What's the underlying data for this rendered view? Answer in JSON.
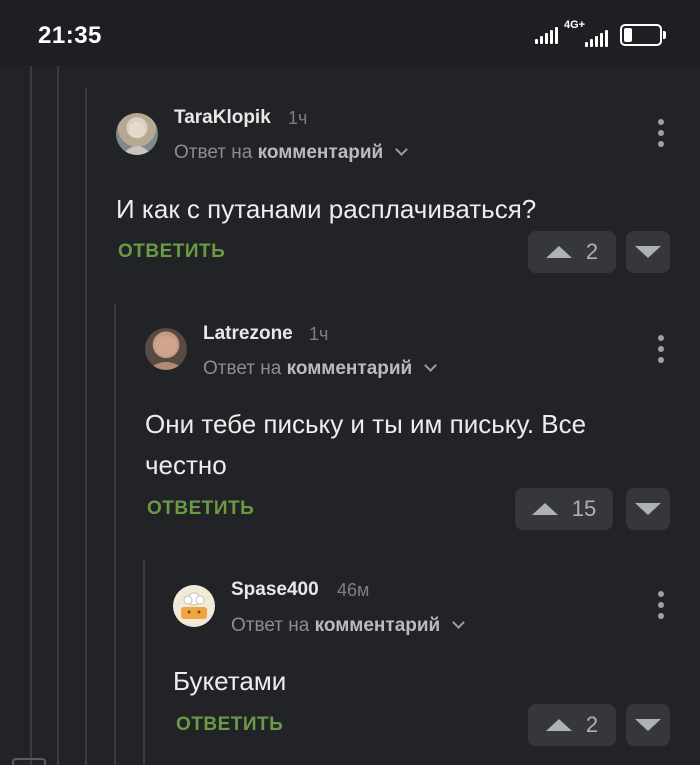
{
  "status_bar": {
    "time": "21:35",
    "network": "4G+",
    "battery": "24",
    "battery_level": 0.24
  },
  "comments": [
    {
      "username": "TaraKlopik",
      "time": "1ч",
      "reply_prefix": "Ответ на",
      "reply_target": "комментарий",
      "text": "И как с путанами расплачиваться?",
      "reply_label": "ОТВЕТИТЬ",
      "votes": "2",
      "avatar_icon": "user-avatar"
    },
    {
      "username": "Latrezone",
      "time": "1ч",
      "reply_prefix": "Ответ на",
      "reply_target": "комментарий",
      "text": "Они тебе письку и ты им письку. Все честно",
      "reply_label": "ОТВЕТИТЬ",
      "votes": "15",
      "avatar_icon": "user-avatar"
    },
    {
      "username": "Spase400",
      "time": "46м",
      "reply_prefix": "Ответ на",
      "reply_target": "комментарий",
      "text": "Букетами",
      "reply_label": "ОТВЕТИТЬ",
      "votes": "2",
      "avatar_icon": "chef-avatar"
    }
  ],
  "colors": {
    "background": "#222326",
    "accent_green": "#6a9a45",
    "thread_line": "#3b3d42"
  }
}
